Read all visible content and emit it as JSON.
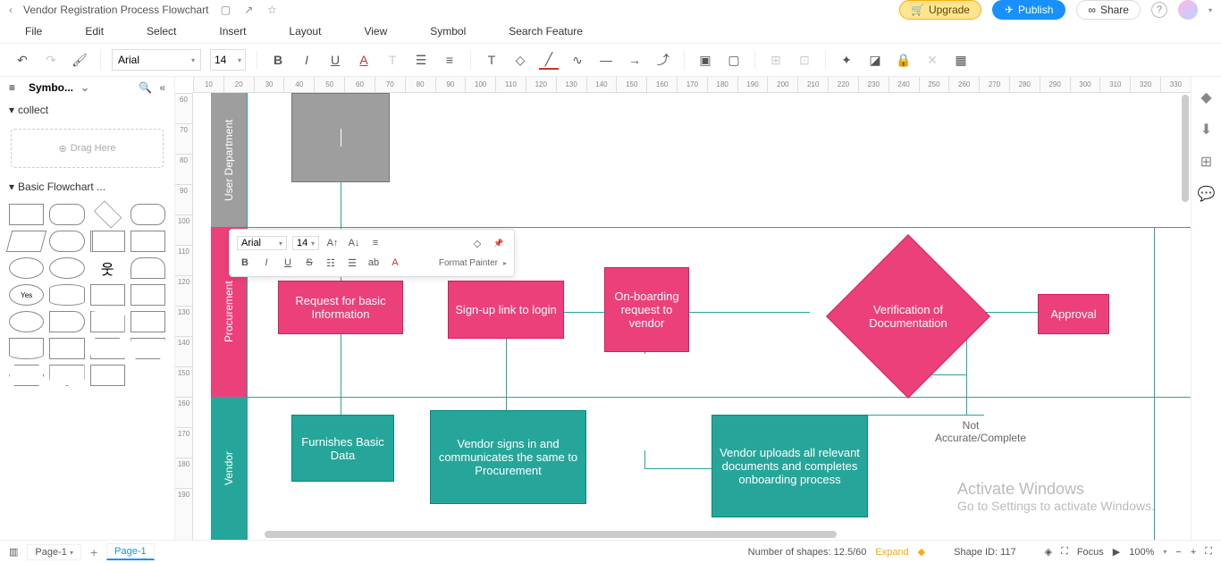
{
  "titlebar": {
    "title": "Vendor Registration Process Flowchart",
    "upgrade": "Upgrade",
    "publish": "Publish",
    "share": "Share"
  },
  "menu": {
    "file": "File",
    "edit": "Edit",
    "select": "Select",
    "insert": "Insert",
    "layout": "Layout",
    "view": "View",
    "symbol": "Symbol",
    "search": "Search Feature"
  },
  "toolbar": {
    "font": "Arial",
    "size": "14"
  },
  "leftpanel": {
    "title": "Symbo...",
    "collect": "collect",
    "drag": "Drag Here",
    "basic": "Basic Flowchart ..."
  },
  "minitb": {
    "font": "Arial",
    "size": "14",
    "format_painter": "Format Painter"
  },
  "ruler_h": [
    "10",
    "20",
    "30",
    "40",
    "50",
    "60",
    "70",
    "80",
    "90",
    "100",
    "110",
    "120",
    "130",
    "140",
    "150",
    "160",
    "170",
    "180",
    "190",
    "200",
    "210",
    "220",
    "230",
    "240",
    "250",
    "260",
    "270",
    "280",
    "290",
    "300",
    "310",
    "320",
    "330"
  ],
  "ruler_v": [
    "60",
    "70",
    "80",
    "90",
    "100",
    "110",
    "120",
    "130",
    "140",
    "150",
    "160",
    "170",
    "180",
    "190"
  ],
  "lanes": {
    "user": "User Department",
    "proc": "Procurement",
    "vend": "Vendor"
  },
  "shapes": {
    "request": "Request for basic Information",
    "signup": "Sign-up link to login",
    "onboard": "On-boarding request to vendor",
    "verify": "Verification of Documentation",
    "approval": "Approval",
    "furnish": "Furnishes Basic Data",
    "signin": "Vendor signs in and communicates the same to Procurement",
    "upload": "Vendor uploads all relevant documents and completes onboarding process",
    "notaccurate": "Not Accurate/Complete"
  },
  "bottom": {
    "page_select": "Page-1",
    "page_tab": "Page-1",
    "shapes_count": "Number of shapes: 12.5/60",
    "expand": "Expand",
    "shape_id": "Shape ID: 117",
    "focus": "Focus",
    "zoom": "100%"
  },
  "watermark": {
    "line1": "Activate Windows",
    "line2": "Go to Settings to activate Windows."
  }
}
